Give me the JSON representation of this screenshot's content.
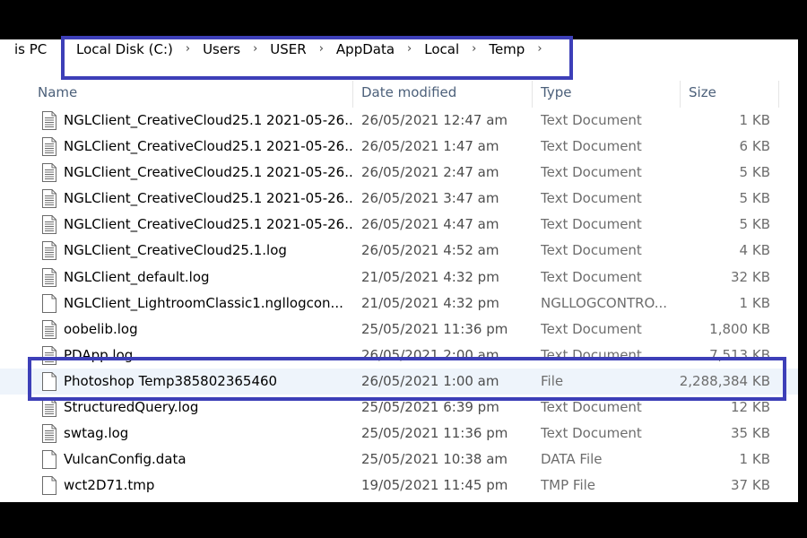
{
  "address": {
    "prefix": "is PC",
    "crumbs": [
      "Local Disk (C:)",
      "Users",
      "USER",
      "AppData",
      "Local",
      "Temp"
    ],
    "separator": "›"
  },
  "columns": {
    "name": "Name",
    "date": "Date modified",
    "type": "Type",
    "size": "Size"
  },
  "files": [
    {
      "name": "NGLClient_CreativeCloud25.1 2021-05-26...",
      "date": "26/05/2021 12:47 am",
      "type": "Text Document",
      "size": "1 KB",
      "icon": "text-document-icon"
    },
    {
      "name": "NGLClient_CreativeCloud25.1 2021-05-26...",
      "date": "26/05/2021 1:47 am",
      "type": "Text Document",
      "size": "6 KB",
      "icon": "text-document-icon"
    },
    {
      "name": "NGLClient_CreativeCloud25.1 2021-05-26...",
      "date": "26/05/2021 2:47 am",
      "type": "Text Document",
      "size": "5 KB",
      "icon": "text-document-icon"
    },
    {
      "name": "NGLClient_CreativeCloud25.1 2021-05-26...",
      "date": "26/05/2021 3:47 am",
      "type": "Text Document",
      "size": "5 KB",
      "icon": "text-document-icon"
    },
    {
      "name": "NGLClient_CreativeCloud25.1 2021-05-26...",
      "date": "26/05/2021 4:47 am",
      "type": "Text Document",
      "size": "5 KB",
      "icon": "text-document-icon"
    },
    {
      "name": "NGLClient_CreativeCloud25.1.log",
      "date": "26/05/2021 4:52 am",
      "type": "Text Document",
      "size": "4 KB",
      "icon": "text-document-icon"
    },
    {
      "name": "NGLClient_default.log",
      "date": "21/05/2021 4:32 pm",
      "type": "Text Document",
      "size": "32 KB",
      "icon": "text-document-icon"
    },
    {
      "name": "NGLClient_LightroomClassic1.ngllogcon...",
      "date": "21/05/2021 4:32 pm",
      "type": "NGLLOGCONTRO...",
      "size": "1 KB",
      "icon": "blank-file-icon"
    },
    {
      "name": "oobelib.log",
      "date": "25/05/2021 11:36 pm",
      "type": "Text Document",
      "size": "1,800 KB",
      "icon": "text-document-icon"
    },
    {
      "name": "PDApp.log",
      "date": "26/05/2021 2:00 am",
      "type": "Text Document",
      "size": "7,513 KB",
      "icon": "text-document-icon"
    },
    {
      "name": "Photoshop Temp385802365460",
      "date": "26/05/2021 1:00 am",
      "type": "File",
      "size": "2,288,384 KB",
      "icon": "blank-file-icon",
      "selected": true
    },
    {
      "name": "StructuredQuery.log",
      "date": "25/05/2021 6:39 pm",
      "type": "Text Document",
      "size": "12 KB",
      "icon": "text-document-icon"
    },
    {
      "name": "swtag.log",
      "date": "25/05/2021 11:36 pm",
      "type": "Text Document",
      "size": "35 KB",
      "icon": "text-document-icon"
    },
    {
      "name": "VulcanConfig.data",
      "date": "25/05/2021 10:38 am",
      "type": "DATA File",
      "size": "1 KB",
      "icon": "blank-file-icon"
    },
    {
      "name": "wct2D71.tmp",
      "date": "19/05/2021 11:45 pm",
      "type": "TMP File",
      "size": "37 KB",
      "icon": "blank-file-icon"
    }
  ],
  "colors": {
    "highlight": "#3d3fb8",
    "selected_row": "#eef4fb",
    "header_text": "#4c607a"
  }
}
